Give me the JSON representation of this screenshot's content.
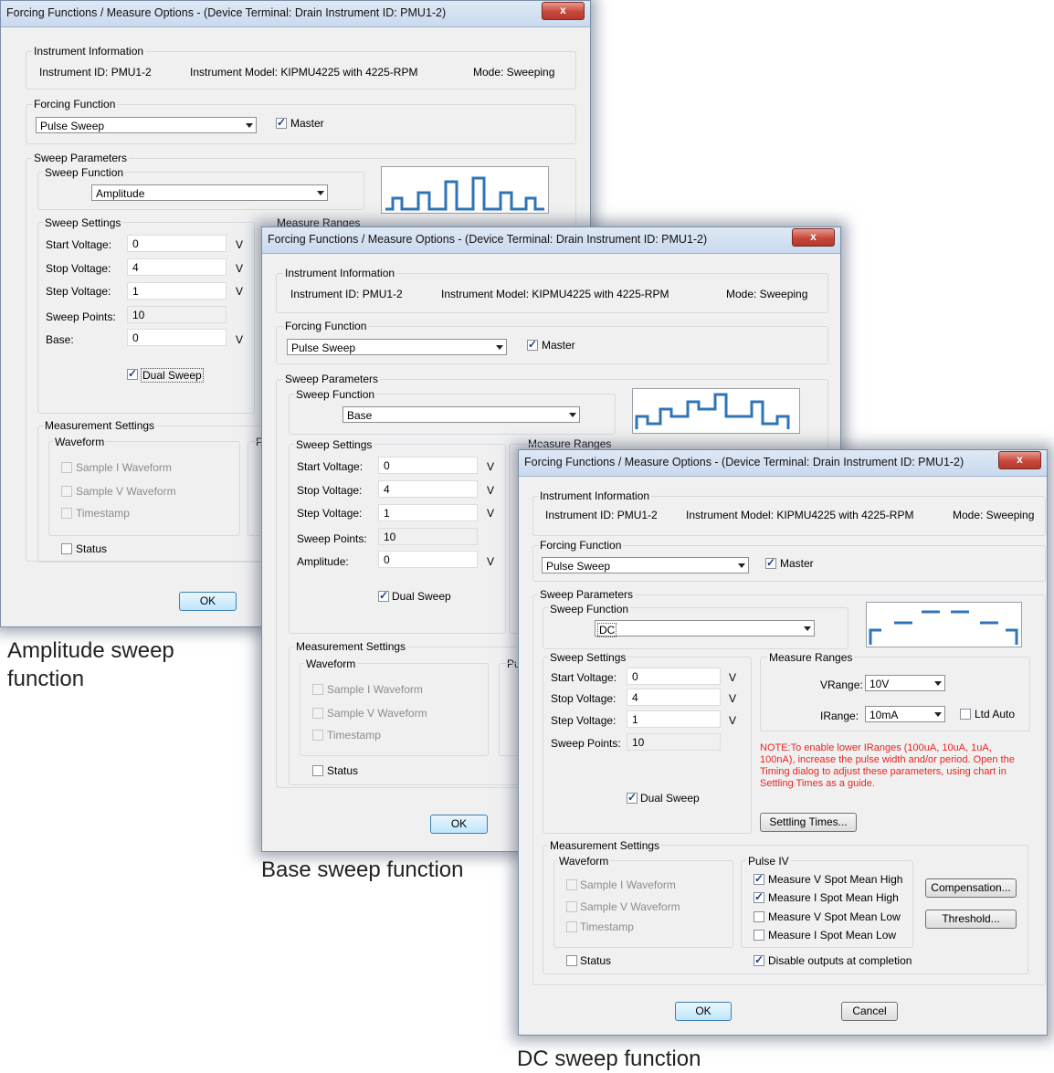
{
  "common": {
    "title": "Forcing Functions / Measure Options - (Device Terminal: Drain  Instrument ID: PMU1-2)",
    "close_label": "x",
    "instrument_information": "Instrument Information",
    "instrument_id_label": "Instrument ID:  PMU1-2",
    "instrument_model_label": "Instrument Model:  KIPMU4225 with 4225-RPM",
    "mode_label": "Mode:  Sweeping",
    "forcing_function": "Forcing Function",
    "forcing_value": "Pulse Sweep",
    "master": "Master",
    "sweep_parameters": "Sweep Parameters",
    "sweep_function": "Sweep Function",
    "sweep_settings": "Sweep Settings",
    "measure_ranges": "Measure Ranges",
    "start_voltage": "Start Voltage:",
    "stop_voltage": "Stop Voltage:",
    "step_voltage": "Step Voltage:",
    "sweep_points": "Sweep Points:",
    "unit_v": "V",
    "start_value": "0",
    "stop_value": "4",
    "step_value": "1",
    "points_value": "10",
    "dual_sweep": "Dual Sweep",
    "measurement_settings": "Measurement Settings",
    "waveform": "Waveform",
    "sample_i": "Sample I Waveform",
    "sample_v": "Sample V Waveform",
    "timestamp": "Timestamp",
    "status": "Status",
    "ok": "OK",
    "cancel": "Cancel",
    "pulse_iv": "Pulse IV",
    "pulse_trunc": "Pu",
    "p_trunc": "P"
  },
  "dialog1": {
    "sweep_function_value": "Amplitude",
    "extra_label": "Base:",
    "extra_value": "0",
    "caption": [
      "Amplitude sweep",
      "function"
    ]
  },
  "dialog2": {
    "sweep_function_value": "Base",
    "extra_label": "Amplitude:",
    "extra_value": "0",
    "caption": [
      "Base sweep function"
    ]
  },
  "dialog3": {
    "sweep_function_value": "DC",
    "vrange_label": "VRange:",
    "vrange_value": "10V",
    "irange_label": "IRange:",
    "irange_value": "10mA",
    "ltd_auto": "Ltd Auto",
    "note": "NOTE:To enable lower IRanges (100uA, 10uA, 1uA, 100nA), increase the pulse width and/or period. Open the Timing dialog to adjust these parameters, using chart in Settling Times as a guide.",
    "settling_times": "Settling Times...",
    "measure_v_high": "Measure V Spot Mean High",
    "measure_i_high": "Measure I Spot Mean High",
    "measure_v_low": "Measure V Spot Mean Low",
    "measure_i_low": "Measure I Spot Mean Low",
    "disable_outputs": "Disable outputs at completion",
    "compensation": "Compensation...",
    "threshold": "Threshold...",
    "caption": [
      "DC sweep function"
    ]
  },
  "colors": {
    "waveform_line": "#2f74b6",
    "note_text": "#e8251f",
    "close_button": "#c8473a"
  }
}
